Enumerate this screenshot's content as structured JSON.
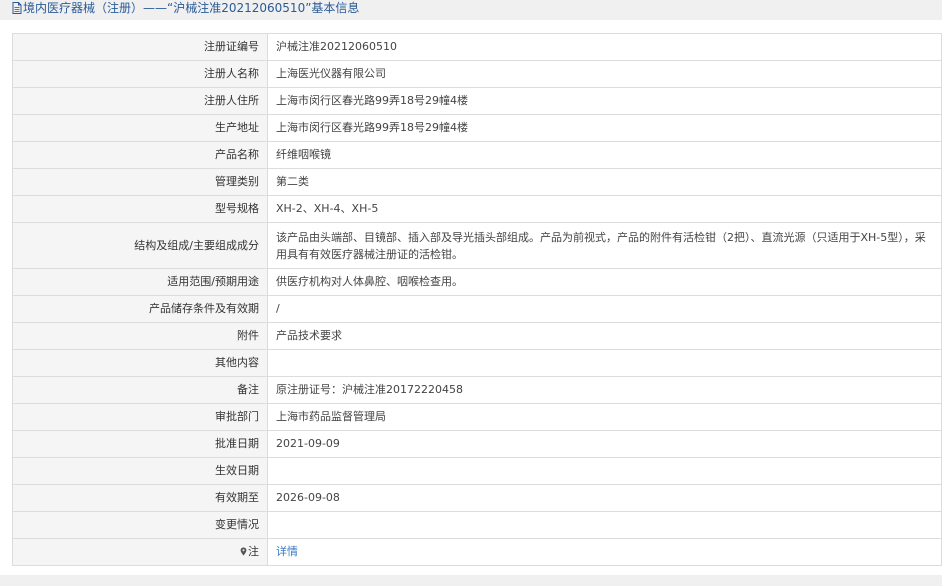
{
  "header": {
    "title": "境内医疗器械（注册）——“沪械注准20212060510”基本信息"
  },
  "rows": [
    {
      "label": "注册证编号",
      "value": "沪械注准20212060510"
    },
    {
      "label": "注册人名称",
      "value": "上海医光仪器有限公司"
    },
    {
      "label": "注册人住所",
      "value": "上海市闵行区春光路99弄18号29幢4楼"
    },
    {
      "label": "生产地址",
      "value": "上海市闵行区春光路99弄18号29幢4楼"
    },
    {
      "label": "产品名称",
      "value": "纤维咽喉镜"
    },
    {
      "label": "管理类别",
      "value": "第二类"
    },
    {
      "label": "型号规格",
      "value": "XH-2、XH-4、XH-5"
    },
    {
      "label": "结构及组成/主要组成成分",
      "value": "该产品由头端部、目镜部、插入部及导光插头部组成。产品为前视式，产品的附件有活检钳（2把）、直流光源（只适用于XH-5型），采用具有有效医疗器械注册证的活检钳。"
    },
    {
      "label": "适用范围/预期用途",
      "value": "供医疗机构对人体鼻腔、咽喉检查用。"
    },
    {
      "label": "产品储存条件及有效期",
      "value": "/"
    },
    {
      "label": "附件",
      "value": "产品技术要求"
    },
    {
      "label": "其他内容",
      "value": ""
    },
    {
      "label": "备注",
      "value": "原注册证号：沪械注准20172220458"
    },
    {
      "label": "审批部门",
      "value": "上海市药品监督管理局"
    },
    {
      "label": "批准日期",
      "value": "2021-09-09"
    },
    {
      "label": "生效日期",
      "value": ""
    },
    {
      "label": "有效期至",
      "value": "2026-09-08"
    },
    {
      "label": "变更情况",
      "value": ""
    },
    {
      "label": "注",
      "value": "详情"
    }
  ],
  "icons": {
    "title_icon": "document-icon",
    "note_icon": "pin-icon"
  },
  "colors": {
    "title": "#2a5b96",
    "link": "#3a78c3",
    "label_bg": "#f5f5f5",
    "border": "#dcdcdc"
  }
}
